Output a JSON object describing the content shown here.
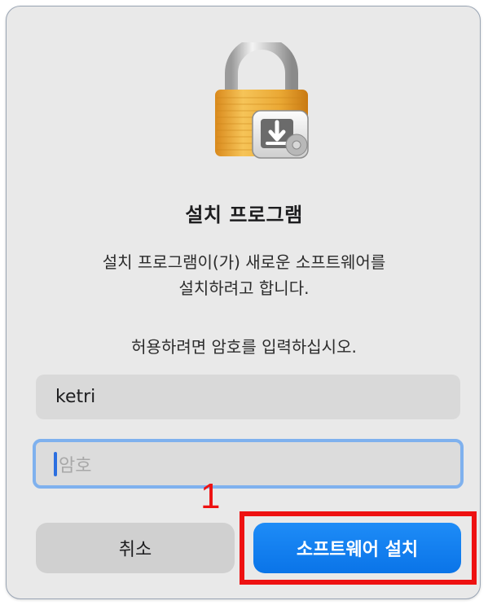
{
  "dialog": {
    "title": "설치 프로그램",
    "message_line1": "설치 프로그램이(가) 새로운 소프트웨어를",
    "message_line2": "설치하려고 합니다.",
    "prompt": "허용하려면 암호를 입력하십시오.",
    "icon": "lock-with-installer-icon"
  },
  "fields": {
    "username_value": "ketri",
    "password_placeholder": "암호"
  },
  "buttons": {
    "cancel_label": "취소",
    "install_label": "소프트웨어 설치"
  },
  "annotation": {
    "step_number": "1",
    "highlight_color": "#ee1111"
  },
  "colors": {
    "accent": "#0a74e8",
    "focus_ring": "#7fb1ee"
  }
}
